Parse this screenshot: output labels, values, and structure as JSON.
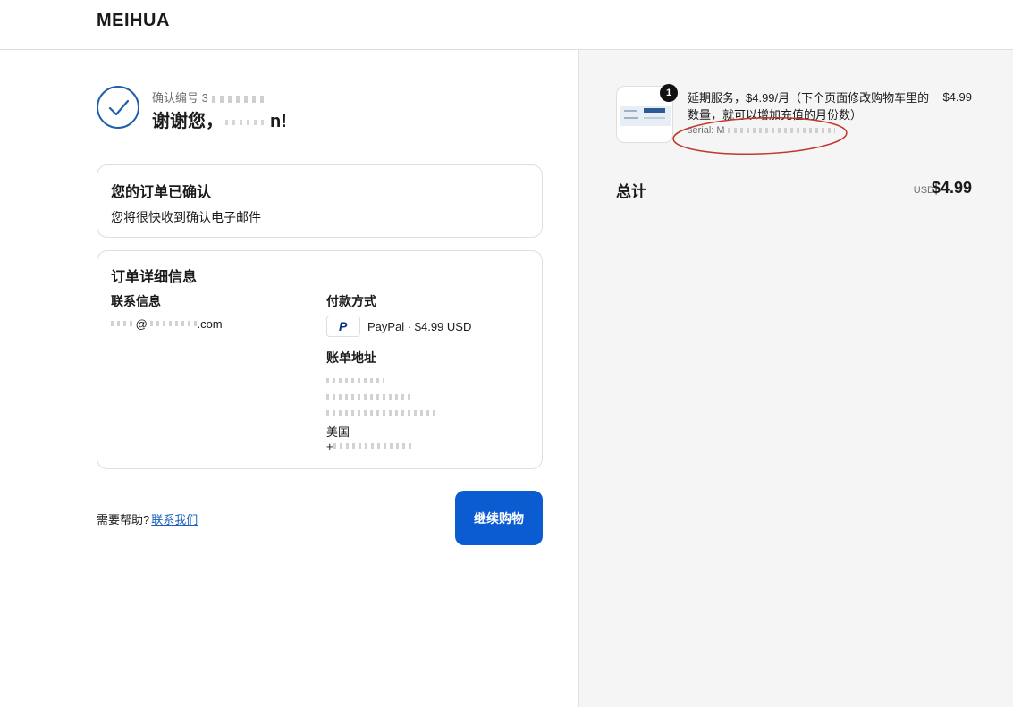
{
  "header": {
    "brand": "MEIHUA"
  },
  "confirmation": {
    "number_label": "确认编号 3",
    "thanks_prefix": "谢谢您，",
    "thanks_suffix": "n!"
  },
  "order_confirmed": {
    "title": "您的订单已确认",
    "subtitle": "您将很快收到确认电子邮件"
  },
  "order_details": {
    "title": "订单详细信息",
    "contact_label": "联系信息",
    "contact_email_at": "@",
    "contact_email_domain": ".com",
    "payment_label": "付款方式",
    "payment_icon": "paypal-icon",
    "payment_value": "PayPal · $4.99 USD",
    "billing_label": "账单地址",
    "billing_country": "美国",
    "billing_phone_prefix": "+"
  },
  "footer": {
    "help_text": "需要帮助?",
    "contact_link": "联系我们",
    "continue_button": "继续购物"
  },
  "summary": {
    "item": {
      "quantity": "1",
      "name": "延期服务，$4.99/月（下个页面修改购物车里的数量，就可以增加充值的月份数）",
      "serial_label": "serial: M",
      "price": "$4.99"
    },
    "total_label": "总计",
    "currency": "USD",
    "total_amount": "$4.99"
  },
  "colors": {
    "primary_button": "#0a5cd0",
    "check_circle": "#1f5fad",
    "link": "#1a5ebc",
    "annotation_ellipse": "#c0392b"
  }
}
